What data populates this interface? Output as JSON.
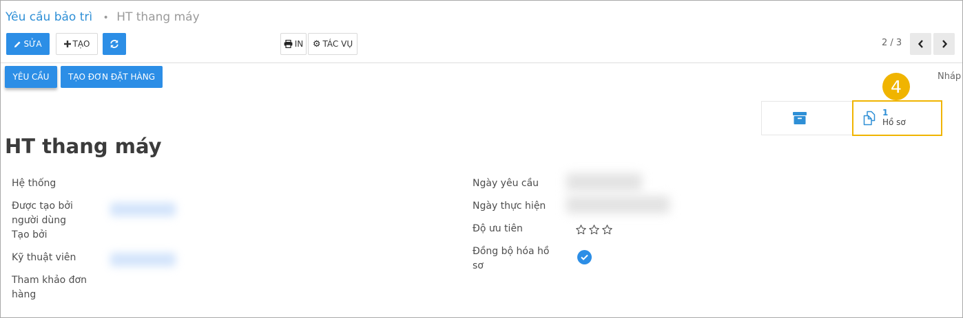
{
  "breadcrumb": {
    "parent": "Yêu cầu bảo trì",
    "separator": "•",
    "current": "HT thang máy"
  },
  "toolbar": {
    "edit_label": "SỬA",
    "create_label": "TẠO",
    "print_label": "IN",
    "action_label": "TÁC VỤ",
    "icons": {
      "edit": "pencil-icon",
      "create": "plus-icon",
      "refresh": "refresh-icon",
      "print": "printer-icon",
      "action": "gear-icon"
    }
  },
  "pager": {
    "value": "2 / 3",
    "prev_icon": "chevron-left-icon",
    "next_icon": "chevron-right-icon"
  },
  "statusbar": {
    "buttons": [
      {
        "label": "YÊU CẦU",
        "active": true
      },
      {
        "label": "TẠO ĐƠN ĐẶT HÀNG",
        "active": false
      }
    ],
    "stage": "Nháp"
  },
  "smart_buttons": {
    "archive_icon": "archive-icon",
    "documents": {
      "count": "1",
      "label": "Hồ sơ",
      "icon": "documents-icon"
    }
  },
  "callout_number": "4",
  "form": {
    "title": "HT thang máy",
    "left_fields": [
      {
        "label": "Hệ thống",
        "value": ""
      },
      {
        "label": "Được tạo bởi người dùng",
        "value": ""
      },
      {
        "label": "Tạo bởi",
        "value": ""
      },
      {
        "label": "Kỹ thuật viên",
        "value": ""
      },
      {
        "label": "Tham khảo đơn hàng",
        "value": ""
      }
    ],
    "right_fields": [
      {
        "label": "Ngày yêu cầu",
        "value": ""
      },
      {
        "label": "Ngày thực hiện",
        "value": ""
      },
      {
        "label": "Độ ưu tiên",
        "value": ""
      },
      {
        "label": "Đồng bộ hóa hồ sơ",
        "value": ""
      }
    ],
    "priority": {
      "value": 0,
      "max": 3
    },
    "sync_documents": true
  },
  "colors": {
    "primary": "#2c8ee6",
    "link": "#2e8fd6",
    "highlight": "#f0b400"
  }
}
